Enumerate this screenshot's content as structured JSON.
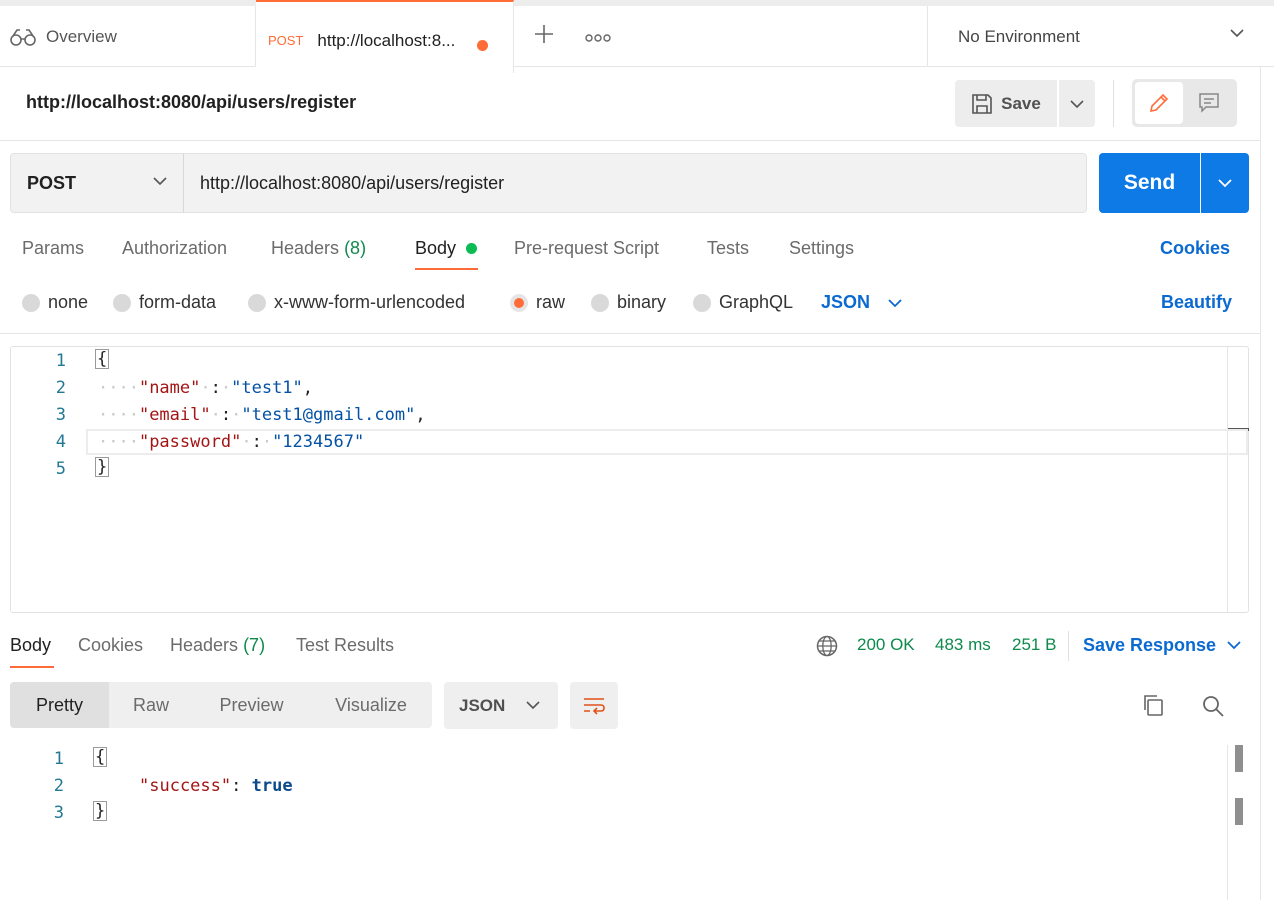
{
  "topbar": {
    "overview_label": "Overview",
    "active_tab": {
      "method": "POST",
      "url": "http://localhost:8..."
    },
    "environment": "No Environment"
  },
  "request": {
    "title": "http://localhost:8080/api/users/register",
    "save_label": "Save",
    "method": "POST",
    "url": "http://localhost:8080/api/users/register",
    "send_label": "Send"
  },
  "request_tabs": {
    "params": "Params",
    "authorization": "Authorization",
    "headers": "Headers",
    "headers_count": "(8)",
    "body": "Body",
    "pre_request": "Pre-request Script",
    "tests": "Tests",
    "settings": "Settings",
    "cookies": "Cookies"
  },
  "body_types": {
    "none": "none",
    "form_data": "form-data",
    "urlencoded": "x-www-form-urlencoded",
    "raw": "raw",
    "binary": "binary",
    "graphql": "GraphQL",
    "selected": "raw",
    "language": "JSON",
    "beautify": "Beautify"
  },
  "request_body": {
    "line_numbers": [
      "1",
      "2",
      "3",
      "4",
      "5"
    ],
    "open_brace": "{",
    "close_brace": "}",
    "fields": [
      {
        "key": "\"name\"",
        "value": "\"test1\"",
        "trail": ","
      },
      {
        "key": "\"email\"",
        "value": "\"test1@gmail.com\"",
        "trail": ","
      },
      {
        "key": "\"password\"",
        "value": "\"1234567\"",
        "trail": ""
      }
    ]
  },
  "response_tabs": {
    "body": "Body",
    "cookies": "Cookies",
    "headers": "Headers",
    "headers_count": "(7)",
    "test_results": "Test Results"
  },
  "response_status": {
    "status": "200 OK",
    "time": "483 ms",
    "size": "251 B",
    "save_response": "Save Response"
  },
  "response_view": {
    "pretty": "Pretty",
    "raw": "Raw",
    "preview": "Preview",
    "visualize": "Visualize",
    "format": "JSON"
  },
  "response_body": {
    "line_numbers": [
      "1",
      "2",
      "3"
    ],
    "open_brace": "{",
    "close_brace": "}",
    "key": "\"success\"",
    "colon": ": ",
    "value": "true"
  },
  "colors": {
    "accent_orange": "#ff6c37",
    "send_blue": "#0d7ae6",
    "link_blue": "#0b6ad1",
    "status_green": "#0e8a4c"
  }
}
